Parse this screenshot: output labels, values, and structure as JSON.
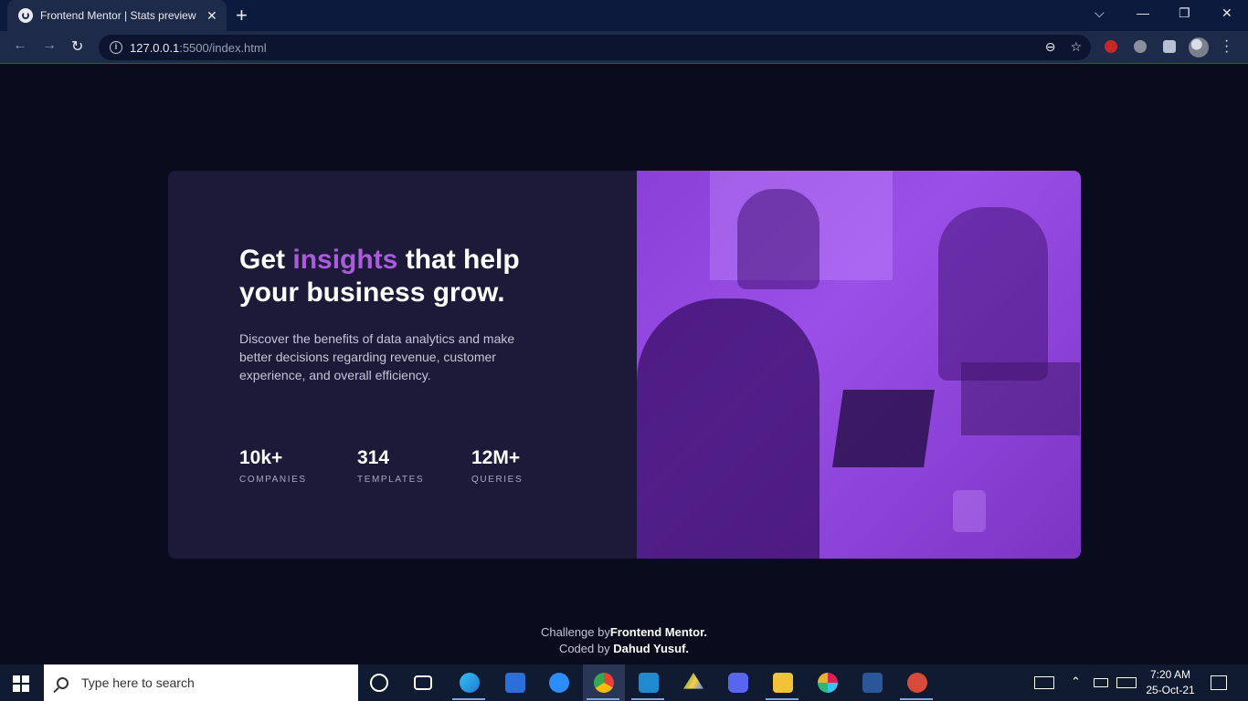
{
  "browser": {
    "tab_title": "Frontend Mentor | Stats preview c",
    "tab_close": "✕",
    "new_tab": "+",
    "url_host": "127.0.0.1",
    "url_path": ":5500/index.html",
    "window_controls": {
      "chevron": "⌵",
      "minimize": "—",
      "restore": "❐",
      "close": "✕"
    },
    "nav_icons": {
      "back": "←",
      "forward": "→",
      "reload": "↻"
    },
    "omnibox_icons": {
      "zoom": "⊖",
      "bookmark": "☆"
    }
  },
  "page": {
    "headline_prefix": "Get ",
    "headline_accent": "insights",
    "headline_suffix": " that help your business grow.",
    "description": "Discover the benefits of data analytics and make better decisions regarding revenue, customer experience, and overall efficiency.",
    "stats": [
      {
        "value": "10k+",
        "label": "COMPANIES"
      },
      {
        "value": "314",
        "label": "TEMPLATES"
      },
      {
        "value": "12M+",
        "label": "QUERIES"
      }
    ],
    "attribution": {
      "challenge_prefix": "Challenge by",
      "challenge_link": "Frontend Mentor",
      "challenge_end": ".",
      "coded_prefix": "Coded by ",
      "coded_name": "Dahud Yusuf",
      "coded_end": "."
    },
    "colors": {
      "accent": "#aa5cdb",
      "card": "#1c1a38",
      "background": "#0a0c1d"
    }
  },
  "taskbar": {
    "search_placeholder": "Type here to search",
    "time": "7:20 AM",
    "date": "25-Oct-21",
    "apps": [
      "cortana-icon",
      "task-view-icon",
      "edge-icon",
      "azure-icon",
      "zoom-icon",
      "chrome-icon",
      "vscode-icon",
      "drive-icon",
      "discord-icon",
      "file-explorer-icon",
      "slack-icon",
      "word-icon",
      "snip-icon"
    ]
  }
}
